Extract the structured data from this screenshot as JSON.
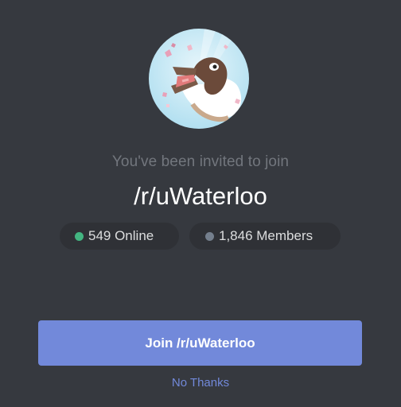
{
  "invite": {
    "avatar_icon": "server-avatar-duck",
    "invited_text": "You've been invited to join",
    "server_name": "/r/uWaterloo",
    "online_count": "549 Online",
    "member_count": "1,846 Members",
    "join_label": "Join /r/uWaterloo",
    "no_thanks_label": "No Thanks"
  },
  "colors": {
    "background": "#36393f",
    "pill": "#2f3136",
    "online_dot": "#43b581",
    "members_dot": "#747f8d",
    "accent": "#7289da"
  }
}
